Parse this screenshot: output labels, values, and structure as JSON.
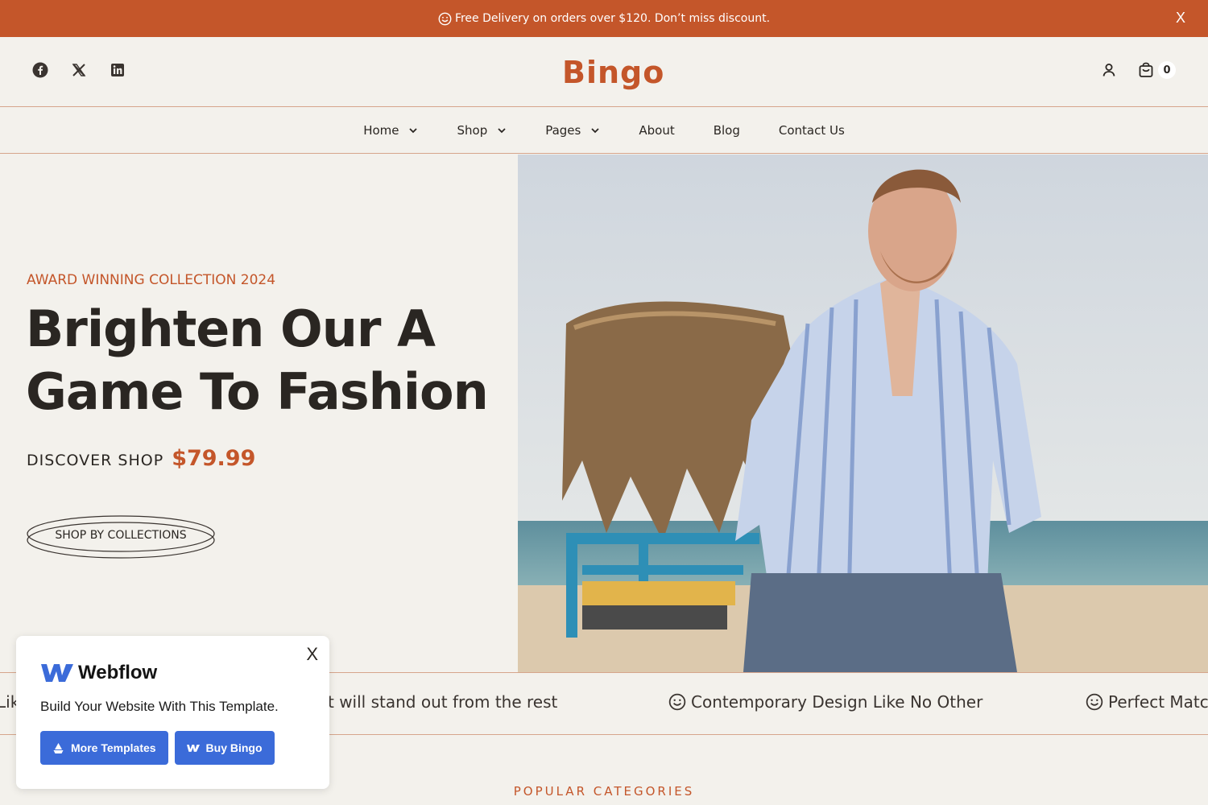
{
  "announcement": {
    "text": "Free Delivery on orders over $120. Don’t miss discount.",
    "close": "X"
  },
  "header": {
    "logo": "Bingo",
    "socials": [
      "facebook-icon",
      "x-twitter-icon",
      "linkedin-icon"
    ],
    "cart_count": "0"
  },
  "nav": {
    "items": [
      {
        "label": "Home",
        "dropdown": true
      },
      {
        "label": "Shop",
        "dropdown": true
      },
      {
        "label": "Pages",
        "dropdown": true
      },
      {
        "label": "About",
        "dropdown": false
      },
      {
        "label": "Blog",
        "dropdown": false
      },
      {
        "label": "Contact Us",
        "dropdown": false
      }
    ]
  },
  "hero": {
    "eyebrow": "AWARD WINNING COLLECTION 2024",
    "headline_line1": "Brighten Our A",
    "headline_line2": "Game To Fashion",
    "discover_label": "DISCOVER SHOP",
    "price": "$79.99",
    "cta": "SHOP BY COLLECTIONS"
  },
  "marquee": {
    "items": [
      "Lik",
      "ct will stand out from the rest",
      "Contemporary Design Like No Other",
      "Perfect Matc"
    ]
  },
  "section": {
    "popular": "POPULAR CATEGORIES"
  },
  "webflow_popup": {
    "brand": "Webflow",
    "tagline": "Build Your Website With This Template.",
    "btn_more": "More Templates",
    "btn_buy": "Buy Bingo",
    "close": "X"
  },
  "colors": {
    "accent": "#c4562a",
    "background": "#f3f1ec",
    "webflow_blue": "#3b6bd9"
  }
}
